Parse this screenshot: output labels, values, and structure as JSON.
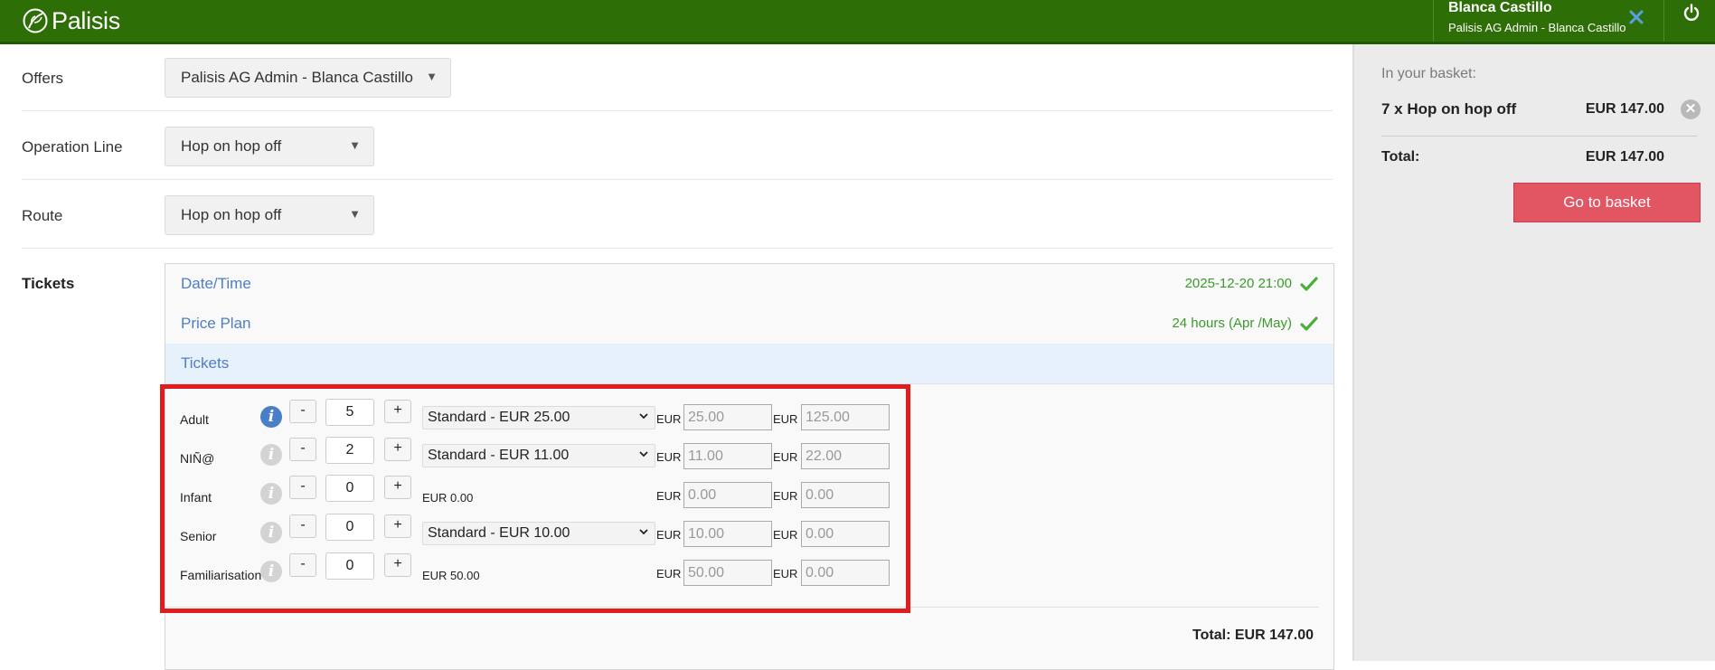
{
  "app": {
    "logo_text": "Palisis"
  },
  "user": {
    "name": "Blanca Castillo",
    "sub": "Palisis AG Admin - Blanca Castillo"
  },
  "form": {
    "offers": {
      "label": "Offers",
      "value": "Palisis AG Admin - Blanca Castillo"
    },
    "operation_line": {
      "label": "Operation Line",
      "value": "Hop on hop off"
    },
    "route": {
      "label": "Route",
      "value": "Hop on hop off"
    },
    "tickets_label": "Tickets"
  },
  "panel": {
    "datetime": {
      "title": "Date/Time",
      "value": "2025-12-20 21:00"
    },
    "price_plan": {
      "title": "Price Plan",
      "value": "24 hours (Apr /May)"
    },
    "tickets": {
      "title": "Tickets"
    },
    "total": "Total: EUR 147.00"
  },
  "ticket_rows": [
    {
      "name": "Adult",
      "qty": "5",
      "rate": "Standard - EUR 25.00",
      "currency": "EUR",
      "price": "25.00",
      "line_total": "125.00",
      "info_active": true
    },
    {
      "name": "NIÑ@",
      "qty": "2",
      "rate": "Standard - EUR 11.00",
      "currency": "EUR",
      "price": "11.00",
      "line_total": "22.00",
      "info_active": false
    },
    {
      "name": "Infant",
      "qty": "0",
      "rate": "EUR 0.00",
      "currency": "EUR",
      "price": "0.00",
      "line_total": "0.00",
      "info_active": false
    },
    {
      "name": "Senior",
      "qty": "0",
      "rate": "Standard - EUR 10.00",
      "currency": "EUR",
      "price": "10.00",
      "line_total": "0.00",
      "info_active": false
    },
    {
      "name": "Familiarisation",
      "qty": "0",
      "rate": "EUR 50.00",
      "currency": "EUR",
      "price": "50.00",
      "line_total": "0.00",
      "info_active": false
    }
  ],
  "buttons": {
    "minus": "-",
    "plus": "+"
  },
  "basket": {
    "label": "In your basket:",
    "item": "7 x Hop on hop off",
    "item_price": "EUR 147.00",
    "total_label": "Total:",
    "total_value": "EUR 147.00",
    "button": "Go to basket"
  },
  "colors": {
    "topbar": "#2e6e06",
    "accent_blue": "#4f7ec4",
    "success_green": "#3a9a2a",
    "basket_button": "#e25563",
    "highlight": "#e01d1d"
  },
  "icons": {
    "logo": "palisis-leaf-icon",
    "close": "close-x-icon",
    "power": "power-icon",
    "check": "check-icon",
    "info": "info-icon",
    "remove": "remove-circle-icon"
  }
}
